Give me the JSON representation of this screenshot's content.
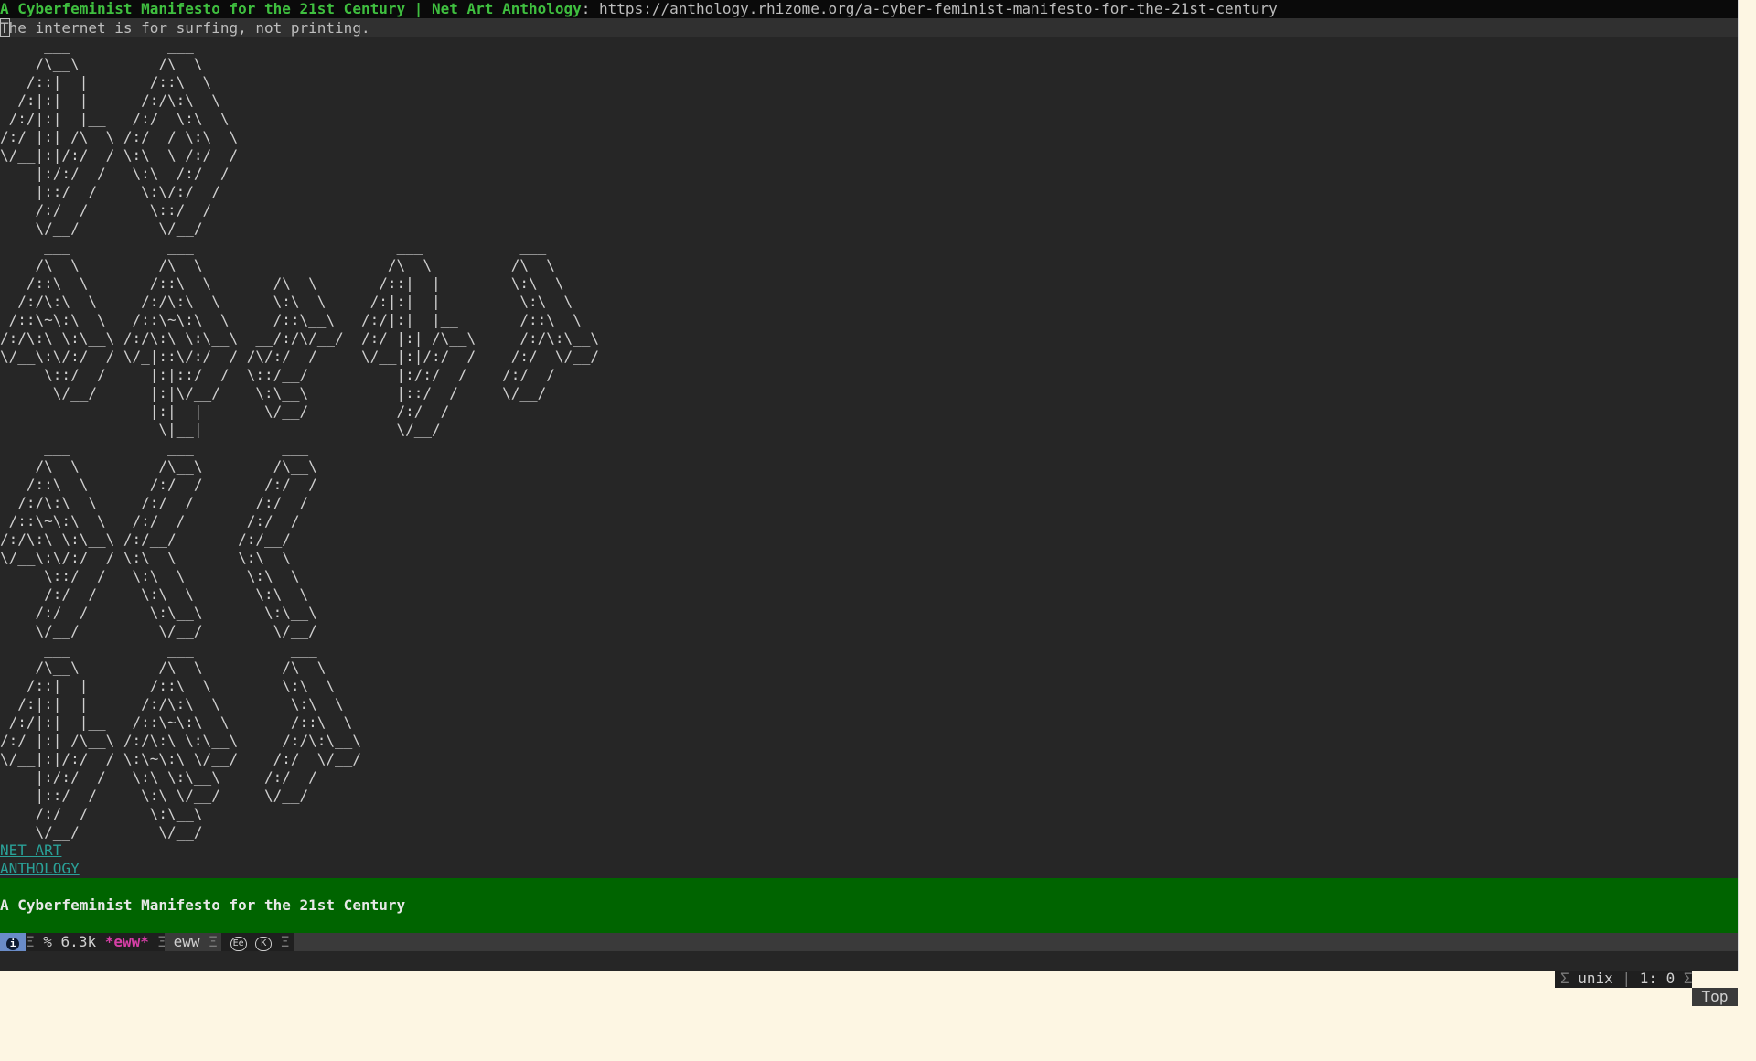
{
  "header_line": {
    "title": "A Cyberfeminist Manifesto for the 21st Century | Net Art Anthology",
    "separator": ": ",
    "url": "https://anthology.rhizome.org/a-cyber-feminist-manifesto-for-the-21st-century"
  },
  "page": {
    "tagline": "The internet is for surfing, not printing.",
    "ascii_art": "     ___           ___\n    /\\__\\         /\\  \\\n   /::|  |       /::\\  \\\n  /:|:|  |      /:/\\:\\  \\\n /:/|:|  |__   /:/  \\:\\  \\\n/:/ |:| /\\__\\ /:/__/ \\:\\__\\\n\\/__|:|/:/  / \\:\\  \\ /:/  /\n    |:/:/  /   \\:\\  /:/  /\n    |::/  /     \\:\\/:/  /\n    /:/  /       \\::/  /\n    \\/__/         \\/__/\n     ___           ___                       ___           ___\n    /\\  \\         /\\  \\         ___         /\\__\\         /\\  \\\n   /::\\  \\       /::\\  \\       /\\  \\       /::|  |        \\:\\  \\\n  /:/\\:\\  \\     /:/\\:\\  \\      \\:\\  \\     /:|:|  |         \\:\\  \\\n /::\\~\\:\\  \\   /::\\~\\:\\  \\     /::\\__\\   /:/|:|  |__       /::\\  \\\n/:/\\:\\ \\:\\__\\ /:/\\:\\ \\:\\__\\  __/:/\\/__/  /:/ |:| /\\__\\     /:/\\:\\__\\\n\\/__\\:\\/:/  / \\/_|::\\/:/  / /\\/:/  /     \\/__|:|/:/  /    /:/  \\/__/\n     \\::/  /     |:|::/  /  \\::/__/          |:/:/  /    /:/  /\n      \\/__/      |:|\\/__/    \\:\\__\\          |::/  /     \\/__/\n                 |:|  |       \\/__/          /:/  /\n                  \\|__|                      \\/__/\n     ___           ___          ___\n    /\\  \\         /\\__\\        /\\__\\\n   /::\\  \\       /:/  /       /:/  /\n  /:/\\:\\  \\     /:/  /       /:/  /\n /::\\~\\:\\  \\   /:/  /       /:/  /\n/:/\\:\\ \\:\\__\\ /:/__/       /:/__/\n\\/__\\:\\/:/  / \\:\\  \\       \\:\\  \\\n     \\::/  /   \\:\\  \\       \\:\\  \\\n     /:/  /     \\:\\  \\       \\:\\  \\\n    /:/  /       \\:\\__\\       \\:\\__\\\n    \\/__/         \\/__/        \\/__/\n     ___           ___           ___\n    /\\__\\         /\\  \\         /\\  \\\n   /::|  |       /::\\  \\        \\:\\  \\\n  /:|:|  |      /:/\\:\\  \\        \\:\\  \\\n /:/|:|  |__   /::\\~\\:\\  \\       /::\\  \\\n/:/ |:| /\\__\\ /:/\\:\\ \\:\\__\\     /:/\\:\\__\\\n\\/__|:|/:/  / \\:\\~\\:\\ \\/__/    /:/  \\/__/\n    |:/:/  /   \\:\\ \\:\\__\\     /:/  /\n    |::/  /     \\:\\ \\/__/     \\/__/\n    /:/  /       \\:\\__\\\n    \\/__/         \\/__/",
    "links": [
      "NET ART",
      "ANTHOLOGY"
    ],
    "heading": "A Cyberfeminist Manifesto for the 21st Century"
  },
  "mode_line": {
    "info_icon": "i",
    "buffer_info": "% 6.3k",
    "buffer_name": "*eww*",
    "major_mode": "eww",
    "minor_modes": [
      "Ee",
      "K"
    ],
    "eol": "unix",
    "line_col": "1: 0",
    "position": "Top"
  },
  "colors": {
    "background": "#262626",
    "title_green": "#3fbf3f",
    "link": "#2aa198",
    "heading_band": "#006400",
    "buffer_name": "#d63fa6",
    "info_icon_bg": "#6a8cc8"
  }
}
